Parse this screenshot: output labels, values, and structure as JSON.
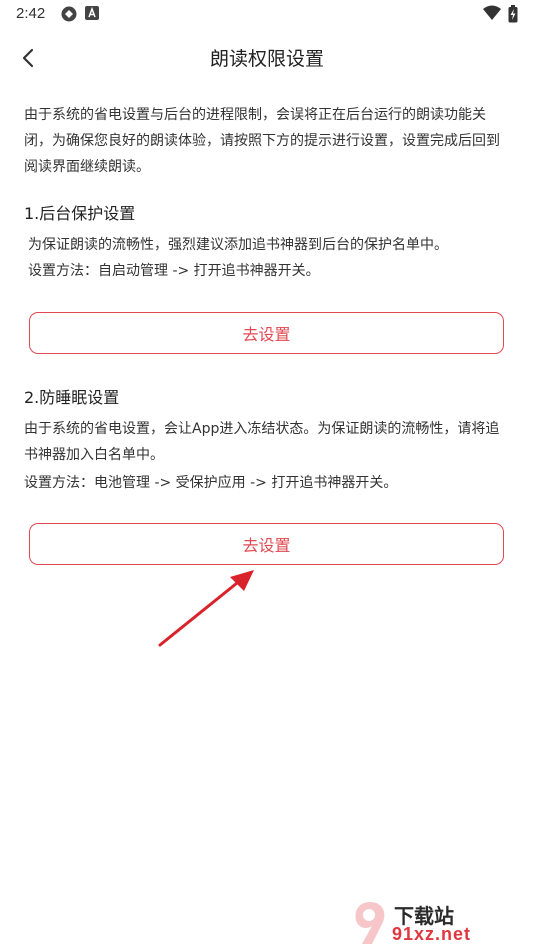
{
  "status_bar": {
    "time": "2:42"
  },
  "header": {
    "title": "朗读权限设置"
  },
  "intro": "由于系统的省电设置与后台的进程限制，会误将正在后台运行的朗读功能关闭，为确保您良好的朗读体验，请按照下方的提示进行设置，设置完成后回到阅读界面继续朗读。",
  "sections": [
    {
      "title": "1.后台保护设置",
      "lines": [
        "为保证朗读的流畅性，强烈建议添加追书神器到后台的保护名单中。",
        "设置方法：自启动管理 -> 打开追书神器开关。"
      ],
      "button_label": "去设置"
    },
    {
      "title": "2.防睡眠设置",
      "lines": [
        "由于系统的省电设置，会让App进入冻结状态。为保证朗读的流畅性，请将追书神器加入白名单中。",
        "设置方法：电池管理 -> 受保护应用 -> 打开追书神器开关。"
      ],
      "button_label": "去设置"
    }
  ],
  "watermark": {
    "line1": "下载站",
    "line2": "91xz.net"
  },
  "colors": {
    "accent": "#e04a52",
    "arrow": "#d9222a"
  }
}
